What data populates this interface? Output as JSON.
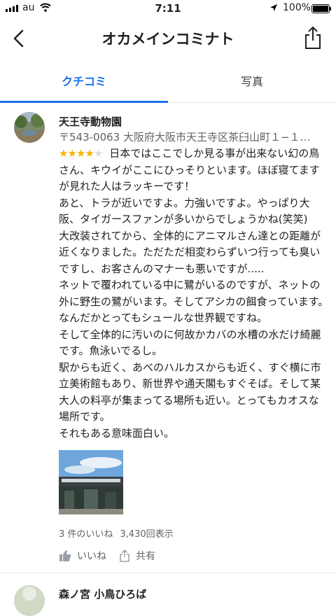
{
  "status_bar": {
    "carrier": "au",
    "time": "7:11",
    "battery_percent": "100%",
    "battery_level": 1.0,
    "icons": [
      "signal-bars-icon",
      "wifi-icon",
      "location-arrow-icon",
      "battery-icon"
    ]
  },
  "header": {
    "title": "オカメインコミナト",
    "icons": [
      "back-arrow-icon",
      "share-icon"
    ]
  },
  "tabs": [
    {
      "label": "クチコミ",
      "active": true
    },
    {
      "label": "写真",
      "active": false
    }
  ],
  "review": {
    "place_name": "天王寺動物園",
    "address": "〒543-0063 大阪府大阪市天王寺区茶臼山町１−１…",
    "rating": 4,
    "rating_max": 5,
    "text": "日本ではここでしか見る事が出来ない幻の鳥さん、キウイがここにひっそりといます。ほぼ寝てますが見れた人はラッキーです！\nあと、トラが近いですよ。力強いですよ。やっぱり大阪、タイガースファンが多いからでしょうかね(笑笑)\n大改装されてから、全体的にアニマルさん達との距離が近くなりました。ただただ相変わらずいつ行っても臭いですし、お客さんのマナーも悪いですが.....\nネットで覆われている中に鷺がいるのですが、ネットの外に野生の鷺がいます。そしてアシカの餌食っています。なんだかとってもシュールな世界観ですね。\nそして全体的に汚いのに何故かカバの水槽の水だけ綺麗です。魚泳いでるし。\n駅からも近く、あべのハルカスからも近く、すぐ横に市立美術館もあり、新世界や通天閣もすぐそば。そして某大人の料亭が集まってる場所も近い。とってもカオスな場所です。\nそれもある意味面白い。",
    "likes": "3 件のいいね",
    "views": "3,430回表示",
    "like_label": "いいね",
    "share_label": "共有",
    "colors": {
      "star": "#f5b400",
      "star_empty": "#dadce0",
      "accent": "#1a73e8"
    }
  },
  "next_review": {
    "name": "森ノ宮 小鳥ひろば"
  }
}
